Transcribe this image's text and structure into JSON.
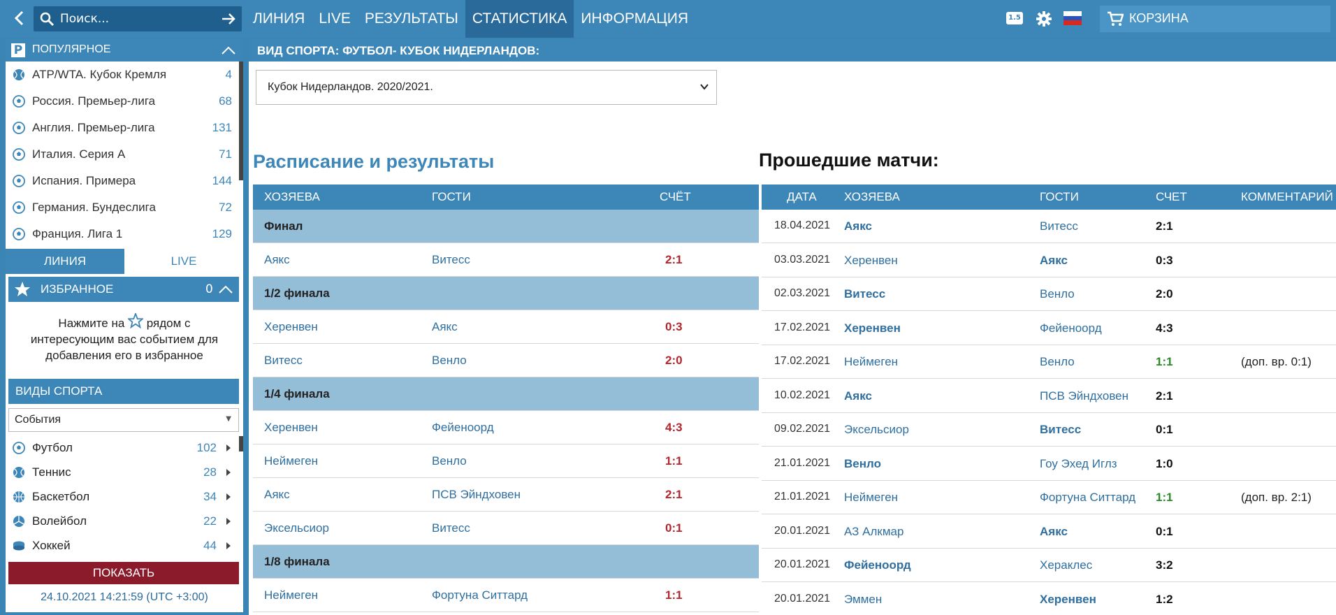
{
  "topbar": {
    "search_placeholder": "Поиск...",
    "nav": [
      "ЛИНИЯ",
      "LIVE",
      "РЕЗУЛЬТАТЫ",
      "СТАТИСТИКА",
      "ИНФОРМАЦИЯ"
    ],
    "active_nav": "СТАТИСТИКА",
    "odds_format": "1.5",
    "cart_label": "КОРЗИНА"
  },
  "sidebar": {
    "popular_title": "ПОПУЛЯРНОЕ",
    "popular": [
      {
        "name": "ATP/WTA. Кубок Кремля",
        "count": "4",
        "icon": "tennis-ball-icon"
      },
      {
        "name": "Россия. Премьер-лига",
        "count": "68",
        "icon": "soccer-ball-icon"
      },
      {
        "name": "Англия. Премьер-лига",
        "count": "131",
        "icon": "soccer-ball-icon"
      },
      {
        "name": "Италия. Серия А",
        "count": "71",
        "icon": "soccer-ball-icon"
      },
      {
        "name": "Испания. Примера",
        "count": "144",
        "icon": "soccer-ball-icon"
      },
      {
        "name": "Германия. Бундеслига",
        "count": "72",
        "icon": "soccer-ball-icon"
      },
      {
        "name": "Франция. Лига 1",
        "count": "129",
        "icon": "soccer-ball-icon"
      }
    ],
    "tab_line": "ЛИНИЯ",
    "tab_live": "LIVE",
    "favorites_title": "ИЗБРАННОЕ",
    "favorites_count": "0",
    "favorites_hint_1": "Нажмите на",
    "favorites_hint_2": "рядом с",
    "favorites_hint_3": "интересующим вас событием для",
    "favorites_hint_4": "добавления его в избранное",
    "sports_title": "ВИДЫ СПОРТА",
    "events_select": "События",
    "sports": [
      {
        "name": "Футбол",
        "count": "102",
        "icon": "soccer-ball-icon"
      },
      {
        "name": "Теннис",
        "count": "28",
        "icon": "tennis-ball-icon"
      },
      {
        "name": "Баскетбол",
        "count": "34",
        "icon": "basketball-icon"
      },
      {
        "name": "Волейбол",
        "count": "22",
        "icon": "volleyball-icon"
      },
      {
        "name": "Хоккей",
        "count": "44",
        "icon": "hockey-puck-icon"
      }
    ],
    "show_button": "ПОКАЗАТЬ",
    "datetime": "24.10.2021 14:21:59 (UTC +3:00)"
  },
  "main": {
    "header": "ВИД СПОРТА: ФУТБОЛ- КУБОК НИДЕРЛАНДОВ:",
    "season": "Кубок Нидерландов. 2020/2021.",
    "schedule_title": "Расписание и результаты",
    "past_title": "Прошедшие матчи:",
    "schedule_cols": [
      "ХОЗЯЕВА",
      "ГОСТИ",
      "СЧЁТ"
    ],
    "schedule_rows": [
      {
        "stage": "Финал"
      },
      {
        "home": "Аякс",
        "away": "Витесс",
        "score": "2:1"
      },
      {
        "stage": "1/2 финала"
      },
      {
        "home": "Херенвен",
        "away": "Аякс",
        "score": "0:3"
      },
      {
        "home": "Витесс",
        "away": "Венло",
        "score": "2:0"
      },
      {
        "stage": "1/4 финала"
      },
      {
        "home": "Херенвен",
        "away": "Фейеноорд",
        "score": "4:3"
      },
      {
        "home": "Неймеген",
        "away": "Венло",
        "score": "1:1"
      },
      {
        "home": "Аякс",
        "away": "ПСВ Эйндховен",
        "score": "2:1"
      },
      {
        "home": "Эксельсиор",
        "away": "Витесс",
        "score": "0:1"
      },
      {
        "stage": "1/8 финала"
      },
      {
        "home": "Неймеген",
        "away": "Фортуна Ситтард",
        "score": "1:1"
      }
    ],
    "past_cols": [
      "ДАТА",
      "ХОЗЯЕВА",
      "ГОСТИ",
      "СЧЕТ",
      "КОММЕНТАРИЙ"
    ],
    "past_rows": [
      {
        "date": "18.04.2021",
        "home": "Аякс",
        "away": "Витесс",
        "score": "2:1",
        "comment": "",
        "win": "home",
        "draw": false
      },
      {
        "date": "03.03.2021",
        "home": "Херенвен",
        "away": "Аякс",
        "score": "0:3",
        "comment": "",
        "win": "away",
        "draw": false
      },
      {
        "date": "02.03.2021",
        "home": "Витесс",
        "away": "Венло",
        "score": "2:0",
        "comment": "",
        "win": "home",
        "draw": false
      },
      {
        "date": "17.02.2021",
        "home": "Херенвен",
        "away": "Фейеноорд",
        "score": "4:3",
        "comment": "",
        "win": "home",
        "draw": false
      },
      {
        "date": "17.02.2021",
        "home": "Неймеген",
        "away": "Венло",
        "score": "1:1",
        "comment": "(доп. вр. 0:1)",
        "win": "",
        "draw": true
      },
      {
        "date": "10.02.2021",
        "home": "Аякс",
        "away": "ПСВ Эйндховен",
        "score": "2:1",
        "comment": "",
        "win": "home",
        "draw": false
      },
      {
        "date": "09.02.2021",
        "home": "Эксельсиор",
        "away": "Витесс",
        "score": "0:1",
        "comment": "",
        "win": "away",
        "draw": false
      },
      {
        "date": "21.01.2021",
        "home": "Венло",
        "away": "Гоу Эхед Иглз",
        "score": "1:0",
        "comment": "",
        "win": "home",
        "draw": false
      },
      {
        "date": "21.01.2021",
        "home": "Неймеген",
        "away": "Фортуна Ситтард",
        "score": "1:1",
        "comment": "(доп. вр. 2:1)",
        "win": "",
        "draw": true
      },
      {
        "date": "20.01.2021",
        "home": "АЗ Алкмар",
        "away": "Аякс",
        "score": "0:1",
        "comment": "",
        "win": "away",
        "draw": false
      },
      {
        "date": "20.01.2021",
        "home": "Фейеноорд",
        "away": "Хераклес",
        "score": "3:2",
        "comment": "",
        "win": "home",
        "draw": false
      },
      {
        "date": "20.01.2021",
        "home": "Эммен",
        "away": "Херенвен",
        "score": "1:2",
        "comment": "",
        "win": "away",
        "draw": false
      }
    ]
  }
}
